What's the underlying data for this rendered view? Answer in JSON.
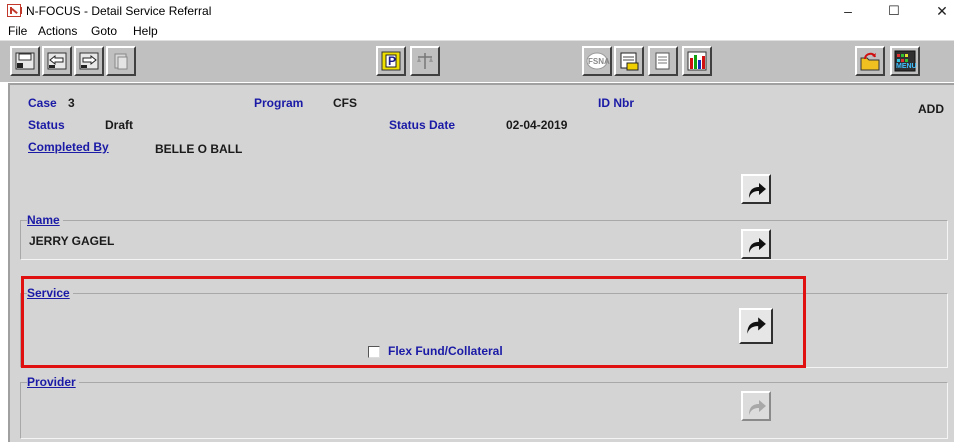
{
  "window": {
    "title": "N-FOCUS - Detail Service Referral",
    "minimize": "–",
    "maximize": "☐",
    "close": "✕"
  },
  "menu": {
    "items": [
      "File",
      "Actions",
      "Goto",
      "Help"
    ]
  },
  "toolbar": {
    "icons": [
      "save-exit-icon",
      "previous-icon",
      "next-icon",
      "copy-icon",
      "p-icon",
      "scale-icon",
      "fsna-icon",
      "report-icon",
      "notes-icon",
      "bar-chart-icon",
      "folder-return-icon",
      "menu-icon"
    ],
    "p_label": "P",
    "fsna_label": "FSNA",
    "menu_label": "MENU"
  },
  "form": {
    "case_label": "Case",
    "case_value": "3",
    "program_label": "Program",
    "program_value": "CFS",
    "id_nbr_label": "ID Nbr",
    "id_nbr_value": "",
    "mode": "ADD",
    "status_label": "Status",
    "status_value": "Draft",
    "status_date_label": "Status Date",
    "status_date_value": "02-04-2019",
    "completed_by_label": "Completed By",
    "completed_by_value": "BELLE O BALL",
    "name_title": "Name",
    "name_value": "JERRY GAGEL",
    "service_title": "Service",
    "flex_fund_label": "Flex Fund/Collateral",
    "flex_fund_checked": false,
    "provider_title": "Provider"
  },
  "colors": {
    "label_blue": "#1a1aa6",
    "form_background": "#d4d4d4",
    "highlight_red": "#e01010"
  }
}
